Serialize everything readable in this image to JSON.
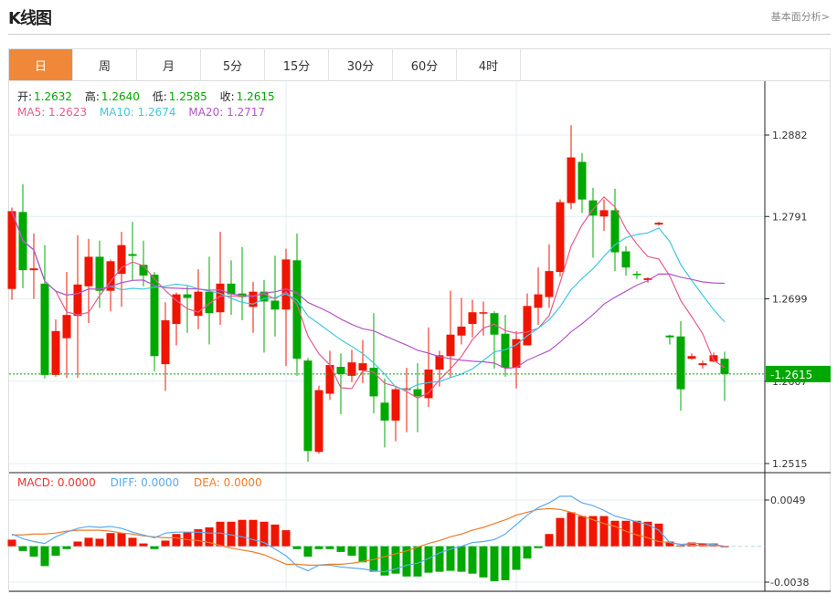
{
  "header": {
    "title": "K线图",
    "link": "基本面分析>"
  },
  "tabs": [
    {
      "label": "日",
      "active": true
    },
    {
      "label": "周"
    },
    {
      "label": "月"
    },
    {
      "label": "5分"
    },
    {
      "label": "15分"
    },
    {
      "label": "30分"
    },
    {
      "label": "60分"
    },
    {
      "label": "4时"
    }
  ],
  "ohlc_info": {
    "open_label": "开:",
    "open": "1.2632",
    "high_label": "高:",
    "high": "1.2640",
    "low_label": "低:",
    "low": "1.2585",
    "close_label": "收:",
    "close": "1.2615"
  },
  "ma_info": {
    "ma5": "MA5: 1.2623",
    "ma10": "MA10: 1.2674",
    "ma20": "MA20: 1.2717"
  },
  "macd_info": {
    "macd": "MACD: 0.0000",
    "diff": "DIFF: 0.0000",
    "dea": "DEA: 0.0000"
  },
  "colors": {
    "up": "#f01500",
    "down": "#00a800",
    "ma5": "#ea5a8e",
    "ma10": "#3ec8dc",
    "ma20": "#b455c8",
    "diff": "#5aaaf0",
    "dea": "#f07d28",
    "accent": "#f0883a"
  },
  "chart_data": {
    "type": "candlestick",
    "price_axis": {
      "ticks": [
        "1.2882",
        "1.2791",
        "1.2699",
        "1.2607",
        "1.2515"
      ],
      "range": [
        1.2515,
        1.2882
      ]
    },
    "last_price": "1.2615",
    "macd_axis": {
      "ticks": [
        "0.0049",
        "-0.0038"
      ],
      "range": [
        -0.0038,
        0.0049
      ]
    },
    "candles_ohlc": [
      [
        1.271,
        1.2801,
        1.2698,
        1.2797
      ],
      [
        1.2796,
        1.2827,
        1.2711,
        1.2731
      ],
      [
        1.2731,
        1.2772,
        1.2699,
        1.2733
      ],
      [
        1.2716,
        1.2759,
        1.261,
        1.2614
      ],
      [
        1.2614,
        1.2676,
        1.2612,
        1.2663
      ],
      [
        1.2655,
        1.2729,
        1.2611,
        1.2681
      ],
      [
        1.268,
        1.277,
        1.2611,
        1.2715
      ],
      [
        1.2713,
        1.2766,
        1.2672,
        1.2746
      ],
      [
        1.2746,
        1.2764,
        1.2689,
        1.2708
      ],
      [
        1.2708,
        1.2743,
        1.2685,
        1.2741
      ],
      [
        1.2727,
        1.2774,
        1.269,
        1.2759
      ],
      [
        1.2749,
        1.2785,
        1.272,
        1.2747
      ],
      [
        1.2737,
        1.2764,
        1.2713,
        1.2725
      ],
      [
        1.2726,
        1.2729,
        1.2618,
        1.2635
      ],
      [
        1.2626,
        1.2695,
        1.2596,
        1.2675
      ],
      [
        1.2671,
        1.2706,
        1.2647,
        1.2704
      ],
      [
        1.2704,
        1.2713,
        1.2661,
        1.27
      ],
      [
        1.268,
        1.2732,
        1.2665,
        1.2707
      ],
      [
        1.2707,
        1.2746,
        1.2648,
        1.2683
      ],
      [
        1.2684,
        1.2774,
        1.267,
        1.2716
      ],
      [
        1.2716,
        1.2742,
        1.2681,
        1.2704
      ],
      [
        1.2705,
        1.2757,
        1.2675,
        1.2701
      ],
      [
        1.269,
        1.2718,
        1.2661,
        1.2707
      ],
      [
        1.2707,
        1.272,
        1.2639,
        1.2696
      ],
      [
        1.2697,
        1.2747,
        1.2657,
        1.2687
      ],
      [
        1.2687,
        1.2755,
        1.2624,
        1.2743
      ],
      [
        1.2742,
        1.2772,
        1.2613,
        1.2632
      ],
      [
        1.263,
        1.2633,
        1.2517,
        1.2529
      ],
      [
        1.2528,
        1.2602,
        1.2526,
        1.2597
      ],
      [
        1.2593,
        1.2641,
        1.2586,
        1.2625
      ],
      [
        1.2623,
        1.2638,
        1.257,
        1.2615
      ],
      [
        1.2613,
        1.2642,
        1.2606,
        1.2628
      ],
      [
        1.2619,
        1.2653,
        1.2605,
        1.2627
      ],
      [
        1.2622,
        1.2683,
        1.2571,
        1.259
      ],
      [
        1.2583,
        1.261,
        1.2533,
        1.2563
      ],
      [
        1.2563,
        1.2601,
        1.254,
        1.2598
      ],
      [
        1.2597,
        1.2622,
        1.255,
        1.2599
      ],
      [
        1.2598,
        1.2627,
        1.255,
        1.259
      ],
      [
        1.2588,
        1.2667,
        1.2578,
        1.262
      ],
      [
        1.262,
        1.2641,
        1.2601,
        1.2636
      ],
      [
        1.2635,
        1.2708,
        1.2611,
        1.2659
      ],
      [
        1.2658,
        1.27,
        1.2648,
        1.2668
      ],
      [
        1.2671,
        1.2698,
        1.2656,
        1.2684
      ],
      [
        1.2683,
        1.2696,
        1.2658,
        1.2684
      ],
      [
        1.2683,
        1.2685,
        1.2621,
        1.2659
      ],
      [
        1.266,
        1.2681,
        1.2612,
        1.2622
      ],
      [
        1.2622,
        1.2663,
        1.2599,
        1.2654
      ],
      [
        1.2647,
        1.2705,
        1.2647,
        1.2691
      ],
      [
        1.2689,
        1.2734,
        1.267,
        1.2704
      ],
      [
        1.2701,
        1.276,
        1.2689,
        1.273
      ],
      [
        1.2729,
        1.281,
        1.2724,
        1.2807
      ],
      [
        1.2806,
        1.2893,
        1.2799,
        1.2857
      ],
      [
        1.2852,
        1.2862,
        1.2795,
        1.281
      ],
      [
        1.2809,
        1.2823,
        1.2745,
        1.2792
      ],
      [
        1.2791,
        1.281,
        1.2775,
        1.2798
      ],
      [
        1.2798,
        1.2822,
        1.273,
        1.2751
      ],
      [
        1.2752,
        1.2758,
        1.2725,
        1.2734
      ],
      [
        1.2727,
        1.273,
        1.2721,
        1.2726
      ],
      [
        1.272,
        1.2723,
        1.2717,
        1.2722
      ],
      [
        1.2782,
        1.2785,
        1.2781,
        1.2784
      ],
      [
        1.2658,
        1.2659,
        1.2648,
        1.2656
      ],
      [
        1.2657,
        1.2674,
        1.2574,
        1.2598
      ],
      [
        1.2632,
        1.2638,
        1.2631,
        1.2635
      ],
      [
        1.2625,
        1.263,
        1.2621,
        1.2627
      ],
      [
        1.2629,
        1.2639,
        1.2628,
        1.2636
      ],
      [
        1.2632,
        1.264,
        1.2585,
        1.2615
      ]
    ],
    "macd_hist": [
      0.0007,
      -0.0005,
      -0.0011,
      -0.0021,
      -0.001,
      -0.0003,
      0.0005,
      0.0009,
      0.0008,
      0.0014,
      0.0014,
      0.0009,
      0.0003,
      -0.0003,
      0.0006,
      0.0013,
      0.0015,
      0.0018,
      0.002,
      0.0026,
      0.0026,
      0.0028,
      0.0028,
      0.0026,
      0.0023,
      0.0017,
      -0.0003,
      -0.0011,
      -0.0003,
      -0.0003,
      -0.0006,
      -0.001,
      -0.0017,
      -0.0027,
      -0.0031,
      -0.0029,
      -0.0032,
      -0.0032,
      -0.0028,
      -0.0027,
      -0.0026,
      -0.0027,
      -0.0029,
      -0.0033,
      -0.0037,
      -0.0036,
      -0.0025,
      -0.0013,
      -0.0002,
      0.0013,
      0.003,
      0.0036,
      0.0032,
      0.0032,
      0.0032,
      0.0027,
      0.0027,
      0.0027,
      0.0026,
      0.0024,
      0.0005,
      0.0001,
      0.0004,
      0.0003,
      0.0003,
      0.0
    ],
    "diff": [
      0.0013,
      0.0008,
      0.0005,
      0.0003,
      0.001,
      0.0015,
      0.0019,
      0.0021,
      0.002,
      0.0021,
      0.0019,
      0.0015,
      0.0012,
      0.0009,
      0.0014,
      0.0015,
      0.0015,
      0.0015,
      0.0014,
      0.0014,
      0.0012,
      0.001,
      0.0007,
      0.0004,
      -0.0003,
      -0.001,
      -0.0021,
      -0.0026,
      -0.002,
      -0.002,
      -0.0022,
      -0.0023,
      -0.0024,
      -0.0026,
      -0.0027,
      -0.0024,
      -0.002,
      -0.0018,
      -0.0013,
      -0.0007,
      -0.0003,
      0.0,
      0.0004,
      0.0005,
      0.0007,
      0.0013,
      0.0023,
      0.0033,
      0.0041,
      0.0046,
      0.0053,
      0.0053,
      0.0046,
      0.0043,
      0.0038,
      0.0032,
      0.0029,
      0.0026,
      0.0023,
      0.0017,
      0.0004,
      0.0002,
      0.0003,
      0.0003,
      0.0002,
      0.0
    ],
    "dea": [
      0.0012,
      0.0012,
      0.0013,
      0.0013,
      0.0014,
      0.0016,
      0.0017,
      0.0017,
      0.0017,
      0.0016,
      0.0014,
      0.0013,
      0.0011,
      0.001,
      0.0009,
      0.0009,
      0.0007,
      0.0006,
      0.0004,
      0.0001,
      -0.0002,
      -0.0004,
      -0.0006,
      -0.0009,
      -0.0014,
      -0.0019,
      -0.0019,
      -0.002,
      -0.002,
      -0.0019,
      -0.0019,
      -0.0018,
      -0.0016,
      -0.0014,
      -0.0011,
      -0.0008,
      -0.0005,
      -0.0001,
      0.0003,
      0.0006,
      0.001,
      0.0013,
      0.0017,
      0.002,
      0.0024,
      0.0028,
      0.0033,
      0.0036,
      0.0039,
      0.004,
      0.0039,
      0.0036,
      0.0032,
      0.0028,
      0.0024,
      0.0021,
      0.0016,
      0.0012,
      0.0009,
      0.0005,
      0.0004,
      0.0002,
      0.0001,
      0.0001,
      0.0001,
      0.0
    ]
  }
}
